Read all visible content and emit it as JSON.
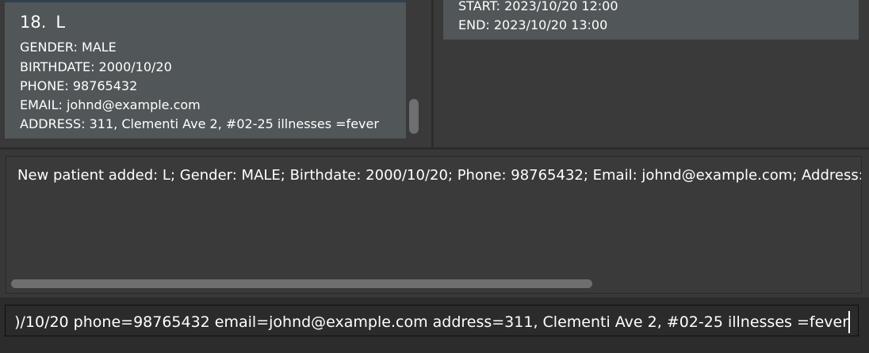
{
  "patient_card": {
    "index": "18.",
    "name": "L",
    "gender": "GENDER: MALE",
    "birthdate": "BIRTHDATE: 2000/10/20",
    "phone": "PHONE: 98765432",
    "email": "EMAIL: johnd@example.com",
    "address_illness": "ADDRESS: 311, Clementi Ave 2, #02-25 illnesses =fever"
  },
  "appointment_card": {
    "start": "START: 2023/10/20 12:00",
    "end": "END: 2023/10/20 13:00"
  },
  "result": {
    "text": "New patient added: L; Gender: MALE; Birthdate: 2000/10/20; Phone: 98765432; Email: johnd@example.com; Address:"
  },
  "command": {
    "value": ")/10/20 phone=98765432 email=johnd@example.com address=311, Clementi Ave 2, #02-25 illnesses =fever"
  }
}
